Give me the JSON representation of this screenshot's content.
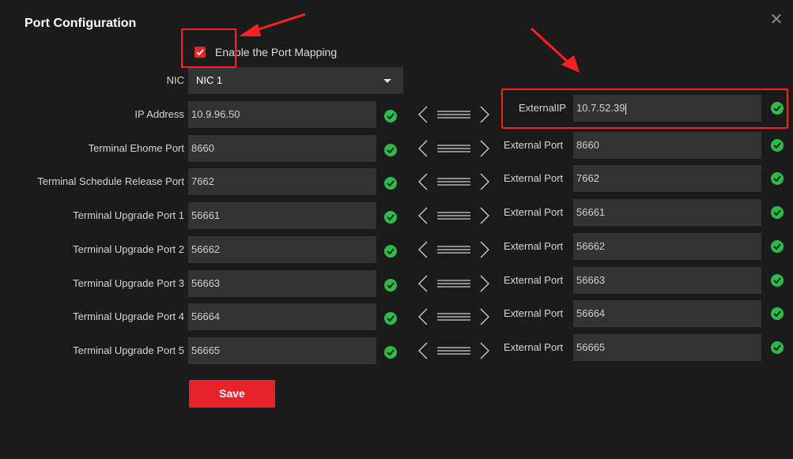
{
  "dialog": {
    "title": "Port Configuration",
    "close_icon": "close-icon"
  },
  "enable": {
    "label": "Enable the Port Mapping",
    "checked": true
  },
  "nic": {
    "label": "NIC",
    "value": "NIC 1"
  },
  "rows": [
    {
      "label": "IP Address",
      "value": "10.9.96.50",
      "ext_label": "ExternalIP",
      "ext_value": "10.7.52.39"
    },
    {
      "label": "Terminal Ehome Port",
      "value": "8660",
      "ext_label": "External Port",
      "ext_value": "8660"
    },
    {
      "label": "Terminal Schedule Release Port",
      "value": "7662",
      "ext_label": "External Port",
      "ext_value": "7662"
    },
    {
      "label": "Terminal Upgrade Port 1",
      "value": "56661",
      "ext_label": "External Port",
      "ext_value": "56661"
    },
    {
      "label": "Terminal Upgrade Port 2",
      "value": "56662",
      "ext_label": "External Port",
      "ext_value": "56662"
    },
    {
      "label": "Terminal Upgrade Port 3",
      "value": "56663",
      "ext_label": "External Port",
      "ext_value": "56663"
    },
    {
      "label": "Terminal Upgrade Port 4",
      "value": "56664",
      "ext_label": "External Port",
      "ext_value": "56664"
    },
    {
      "label": "Terminal Upgrade Port 5",
      "value": "56665",
      "ext_label": "External Port",
      "ext_value": "56665"
    }
  ],
  "save_label": "Save",
  "colors": {
    "accent": "#e8222b",
    "valid": "#2bbd4a",
    "background": "#1b1b1b",
    "field": "#333333",
    "annotation": "#ff1f1f"
  }
}
